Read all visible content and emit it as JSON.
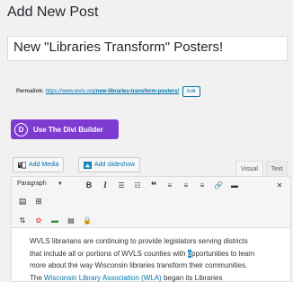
{
  "page": {
    "title": "Add New Post"
  },
  "post": {
    "title_value": "New \"Libraries Transform\" Posters!"
  },
  "permalink": {
    "label": "Permalink:",
    "url_base": "https://www.wvls.org/",
    "url_slug": "new-libraries-transform-posters/",
    "edit_label": "Edit"
  },
  "divi": {
    "icon_letter": "D",
    "label": "Use The Divi Builder",
    "color": "#7e3bd0"
  },
  "media": {
    "add_media_label": "Add Media",
    "add_slideshow_label": "Add slideshow"
  },
  "tabs": {
    "visual_label": "Visual",
    "text_label": "Text"
  },
  "toolbar": {
    "format_select_value": "Paragraph",
    "icons": [
      "bold-icon",
      "italic-icon",
      "bulleted-list-icon",
      "numbered-list-icon",
      "blockquote-icon",
      "align-left-icon",
      "align-center-icon",
      "align-right-icon",
      "link-icon",
      "read-more-icon",
      "fullscreen-icon",
      "toolbar-toggle-icon",
      "grid-icon",
      "translate-icon",
      "color-icon",
      "divider-icon",
      "table-icon",
      "lock-icon"
    ]
  },
  "editor": {
    "line1": "WVLS librarians are continuing to provide legislators serving districts",
    "line2_a": "that include all or portions of WVLS counties with ",
    "line2_sel": "o",
    "line2_b": "pportunities to learn",
    "line3": "more about the way Wisconsin libraries transform their communities.",
    "line4_a": "The ",
    "line4_link": "Wisconsin Library Association (WLA)",
    "line4_b": " began its Libraries"
  },
  "colors": {
    "link": "#0073aa",
    "divi_purple": "#7e3bd0",
    "background": "#f1f1f1"
  }
}
